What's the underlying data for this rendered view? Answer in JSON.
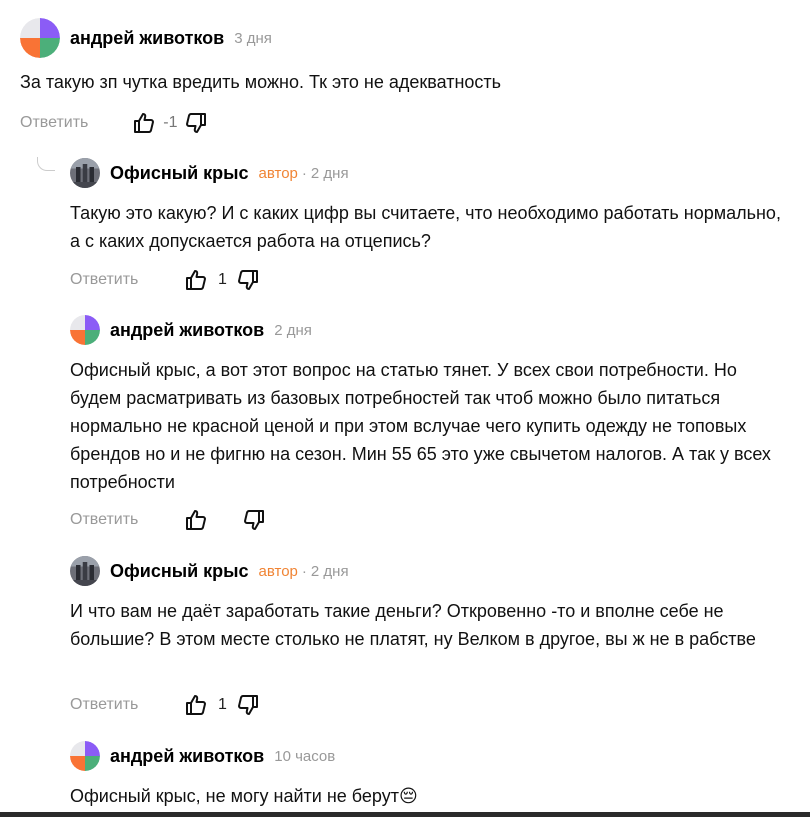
{
  "comments": [
    {
      "author": "андрей животков",
      "badge": "",
      "time": "3 дня",
      "text": "За такую зп чутка вредить можно. Тк это не адекватность",
      "reply": "Ответить",
      "score": "-1",
      "avatar": "multicolor-avatar"
    },
    {
      "author": "Офисный крыс",
      "badge": "автор",
      "time": "2 дня",
      "text": "Такую это какую? И с каких цифр вы считаете, что необходимо работать нормально, а с каких допускается работа на отцепись?",
      "reply": "Ответить",
      "score": "1",
      "avatar": "photo-avatar"
    },
    {
      "author": "андрей животков",
      "badge": "",
      "time": "2 дня",
      "text": "Офисный крыс, а вот этот вопрос на статью тянет. У всех свои потребности. Но будем расматривать из базовых потребностей так чтоб можно было питаться нормально не красной ценой и при этом вслучае чего купить одежду не топовых брендов но и не фигню на сезон. Мин 55 65 это уже свычетом налогов. А так у всех потребности",
      "reply": "Ответить",
      "score": "",
      "avatar": "multicolor-avatar"
    },
    {
      "author": "Офисный крыс",
      "badge": "автор",
      "time": "2 дня",
      "text": "И что вам не даёт заработать такие деньги? Откровенно -то и вполне себе не большие? В этом месте столько не платят, ну Велком в другое, вы ж не в рабстве",
      "reply": "Ответить",
      "score": "1",
      "avatar": "photo-avatar"
    },
    {
      "author": "андрей животков",
      "badge": "",
      "time": "10 часов",
      "text": "Офисный крыс, не могу найти не берут",
      "emoji": "😔",
      "reply": "",
      "score": "",
      "avatar": "multicolor-avatar"
    }
  ],
  "colors": {
    "author_badge": "#f08434",
    "muted": "#999999",
    "avatar_purple": "#8b5cf6",
    "avatar_orange": "#f97335",
    "avatar_green": "#4caf7a"
  },
  "icons": [
    "thumbs-up-icon",
    "thumbs-down-icon",
    "thread-connector-icon"
  ]
}
